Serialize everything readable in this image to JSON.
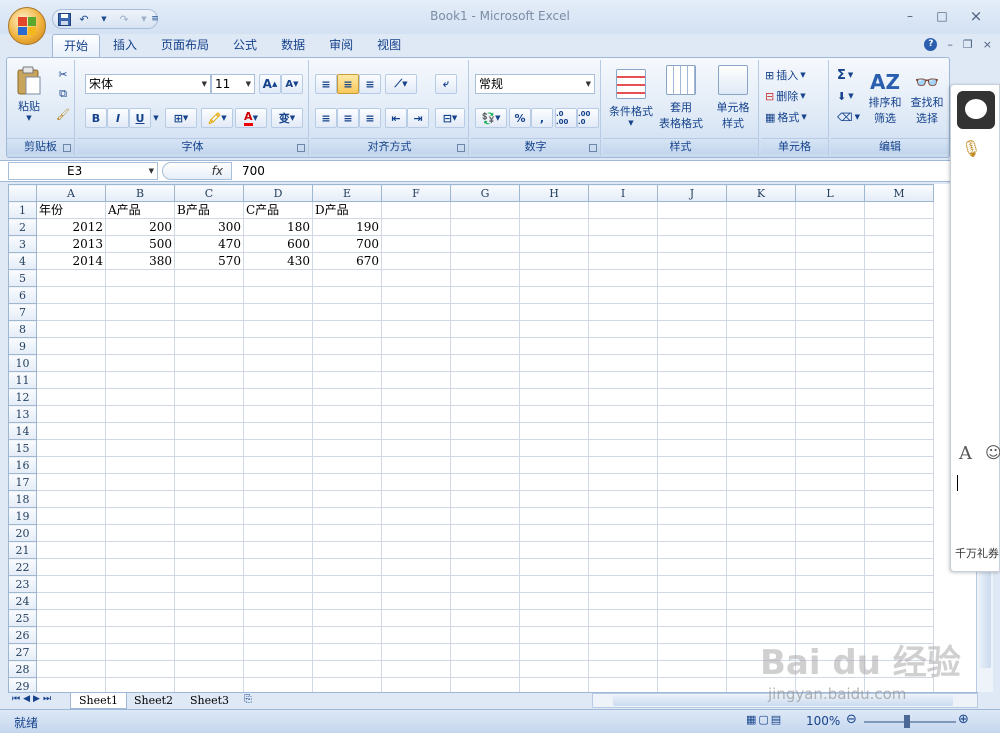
{
  "window": {
    "title": "Book1 - Microsoft Excel",
    "minimize": "–",
    "maximize": "□",
    "close": "×"
  },
  "qat": {
    "save": "save-icon",
    "undo": "undo-icon",
    "redo": "redo-icon"
  },
  "tabs": [
    "开始",
    "插入",
    "页面布局",
    "公式",
    "数据",
    "审阅",
    "视图"
  ],
  "ribbon": {
    "clipboard": {
      "label": "剪贴板",
      "paste": "粘贴"
    },
    "font": {
      "label": "字体",
      "name": "宋体",
      "size": "11",
      "bold": "B",
      "italic": "I",
      "underline": "U",
      "grow": "A",
      "shrink": "A",
      "font_color": "A",
      "wen": "wén",
      "wen_char": "变"
    },
    "alignment": {
      "label": "对齐方式"
    },
    "number": {
      "label": "数字",
      "format": "常规",
      "percent": "%",
      "comma": ",",
      "inc_decimal": ".0 .00",
      "dec_decimal": ".00 .0"
    },
    "styles": {
      "label": "样式",
      "cond_format": "条件格式",
      "table_format_1": "套用",
      "table_format_2": "表格格式",
      "cell_style_1": "单元格",
      "cell_style_2": "样式"
    },
    "cells": {
      "label": "单元格",
      "insert": "插入",
      "delete": "删除",
      "format": "格式"
    },
    "editing": {
      "label": "编辑",
      "sum": "Σ",
      "sort_1": "排序和",
      "sort_2": "筛选",
      "find_1": "查找和",
      "find_2": "选择"
    }
  },
  "formula_bar": {
    "name_box": "E3",
    "fx": "fx",
    "value": "700"
  },
  "columns": [
    "A",
    "B",
    "C",
    "D",
    "E",
    "F",
    "G",
    "H",
    "I",
    "J",
    "K",
    "L",
    "M"
  ],
  "rows": [
    [
      "年份",
      "A产品",
      "B产品",
      "C产品",
      "D产品",
      "",
      "",
      "",
      "",
      "",
      "",
      "",
      ""
    ],
    [
      "2012",
      "200",
      "300",
      "180",
      "190",
      "",
      "",
      "",
      "",
      "",
      "",
      "",
      ""
    ],
    [
      "2013",
      "500",
      "470",
      "600",
      "700",
      "",
      "",
      "",
      "",
      "",
      "",
      "",
      ""
    ],
    [
      "2014",
      "380",
      "570",
      "430",
      "670",
      "",
      "",
      "",
      "",
      "",
      "",
      "",
      ""
    ]
  ],
  "row_count": 29,
  "sheet_tabs": [
    "Sheet1",
    "Sheet2",
    "Sheet3"
  ],
  "status": {
    "ready": "就绪",
    "zoom": "100%"
  },
  "side_panel": {
    "promo": "千万礼券",
    "font_glyph": "A"
  },
  "watermark": {
    "brand": "Bai du 经验",
    "url": "jingyan.baidu.com"
  }
}
